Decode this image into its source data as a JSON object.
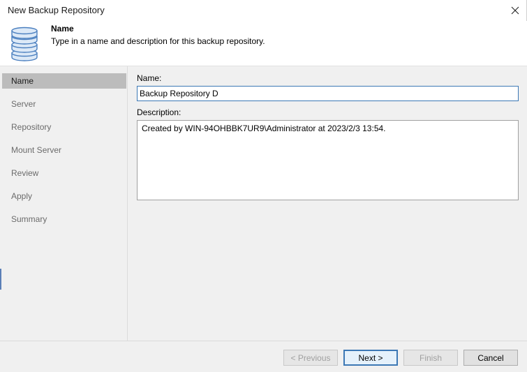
{
  "window": {
    "title": "New Backup Repository"
  },
  "header": {
    "title": "Name",
    "description": "Type in a name and description for this backup repository."
  },
  "sidebar": {
    "items": [
      {
        "label": "Name",
        "active": true
      },
      {
        "label": "Server",
        "active": false
      },
      {
        "label": "Repository",
        "active": false
      },
      {
        "label": "Mount Server",
        "active": false
      },
      {
        "label": "Review",
        "active": false
      },
      {
        "label": "Apply",
        "active": false
      },
      {
        "label": "Summary",
        "active": false
      }
    ]
  },
  "form": {
    "name_label": "Name:",
    "name_value": "Backup Repository D",
    "description_label": "Description:",
    "description_value": "Created by WIN-94OHBBK7UR9\\Administrator at 2023/2/3 13:54."
  },
  "footer": {
    "previous_label": "< Previous",
    "next_label": "Next >",
    "finish_label": "Finish",
    "cancel_label": "Cancel"
  },
  "colors": {
    "accent": "#3c78b5",
    "active_step_bg": "#bcbcbc",
    "panel_bg": "#f0f0f0",
    "icon_fill": "#dce9f7",
    "icon_stroke": "#4a7fbf"
  },
  "icons": {
    "header": "database-icon",
    "close": "close-icon"
  }
}
